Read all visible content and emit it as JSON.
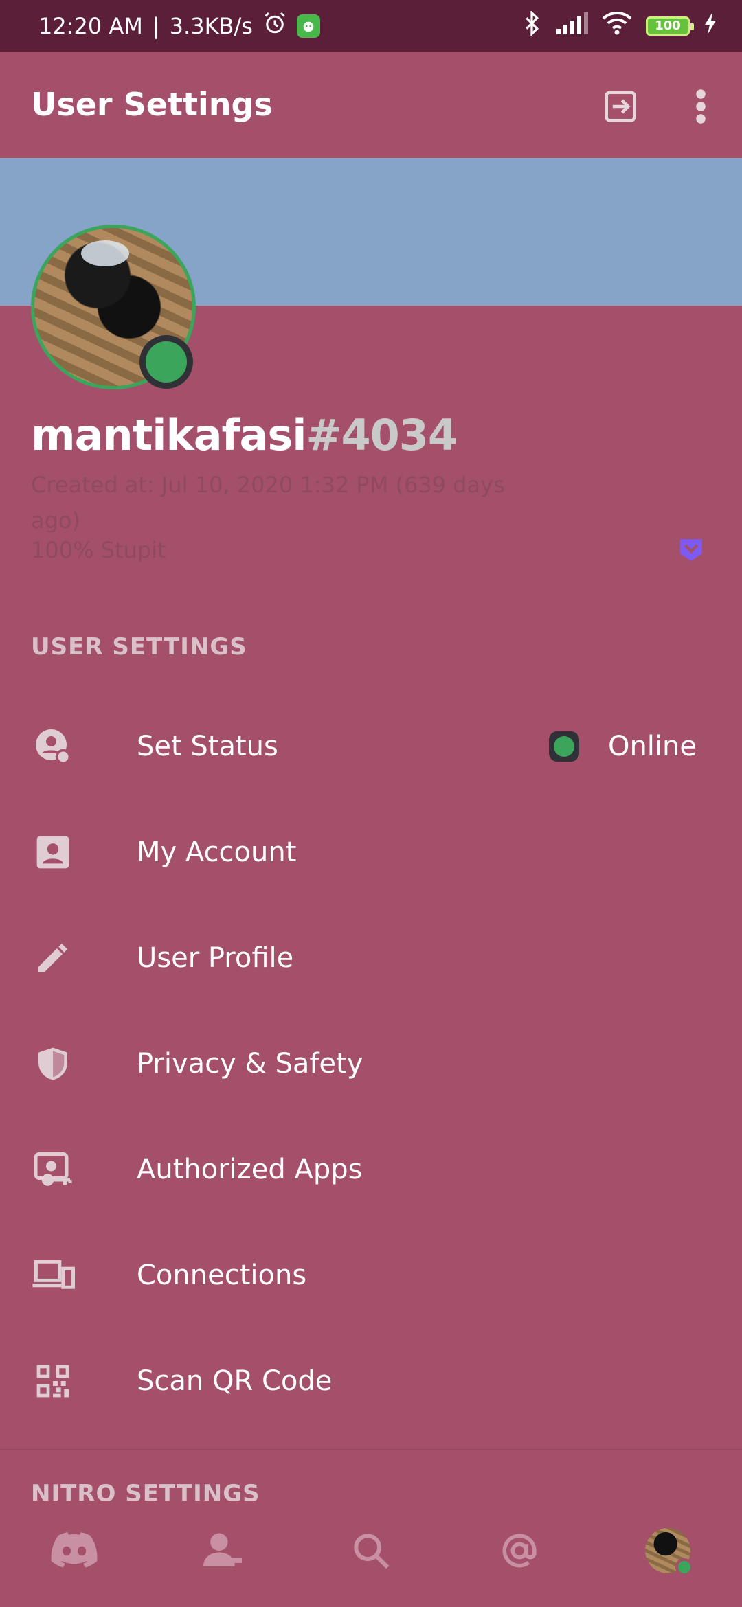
{
  "status_bar": {
    "time": "12:20 AM",
    "speed": "3.3KB/s",
    "battery": "100",
    "icons": [
      "alarm-icon",
      "app-notification-icon",
      "bluetooth-icon",
      "signal-icon",
      "wifi-icon",
      "battery-icon",
      "charging-icon"
    ]
  },
  "header": {
    "title": "User Settings",
    "actions": [
      "logout-icon",
      "more-vertical-icon"
    ]
  },
  "profile": {
    "username": "mantikafasi",
    "discriminator": "#4034",
    "created": "Created at: Jul 10, 2020 1:32 PM (639 days ago)",
    "bio": "100% Stupit",
    "status": "online",
    "colors": {
      "banner": "#86a3c8",
      "background": "#a4506b",
      "online": "#3ba55c"
    }
  },
  "sections": {
    "user_settings": "USER SETTINGS",
    "nitro_settings": "NITRO SETTINGS"
  },
  "menu": {
    "items": [
      {
        "label": "Set Status",
        "icon": "status-icon",
        "value": "Online"
      },
      {
        "label": "My Account",
        "icon": "account-icon"
      },
      {
        "label": "User Profile",
        "icon": "pencil-icon"
      },
      {
        "label": "Privacy & Safety",
        "icon": "shield-icon"
      },
      {
        "label": "Authorized Apps",
        "icon": "authorized-apps-icon"
      },
      {
        "label": "Connections",
        "icon": "devices-icon"
      },
      {
        "label": "Scan QR Code",
        "icon": "qr-code-icon"
      }
    ]
  },
  "bottom_nav": {
    "items": [
      "discord-home-icon",
      "friends-icon",
      "search-icon",
      "mentions-icon",
      "profile-avatar"
    ]
  }
}
